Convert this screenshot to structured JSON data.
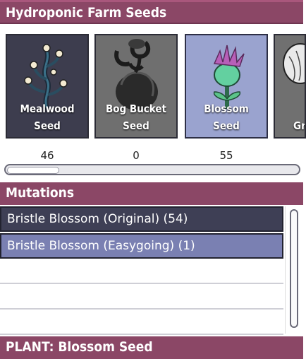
{
  "window": {
    "title": "Hydroponic Farm Seeds"
  },
  "seeds": [
    {
      "id": "mealwood",
      "label": "Mealwood\nSeed",
      "count": "46",
      "icon": "mealwood-seed-icon",
      "selected": false
    },
    {
      "id": "bog",
      "label": "Bog Bucket\nSeed",
      "count": "0",
      "icon": "bog-bucket-seed-icon",
      "selected": false
    },
    {
      "id": "blossom",
      "label": "Blossom\nSeed",
      "count": "55",
      "icon": "blossom-seed-icon",
      "selected": true
    },
    {
      "id": "gr",
      "label": "Gr",
      "count": "",
      "icon": "partial-seed-icon",
      "selected": false
    }
  ],
  "seed_scroll": {
    "position": 0
  },
  "mutations": {
    "title": "Mutations",
    "items": [
      {
        "label": "Bristle Blossom (Original) (54)",
        "selected": false
      },
      {
        "label": "Bristle Blossom (Easygoing) (1)",
        "selected": true
      }
    ]
  },
  "footer": {
    "label": "PLANT: Blossom Seed"
  },
  "colors": {
    "header_bg": "#8b4766",
    "row_dark": "#3e3f55",
    "row_selected": "#7a80b2",
    "card_selected": "#9aa3cf"
  }
}
